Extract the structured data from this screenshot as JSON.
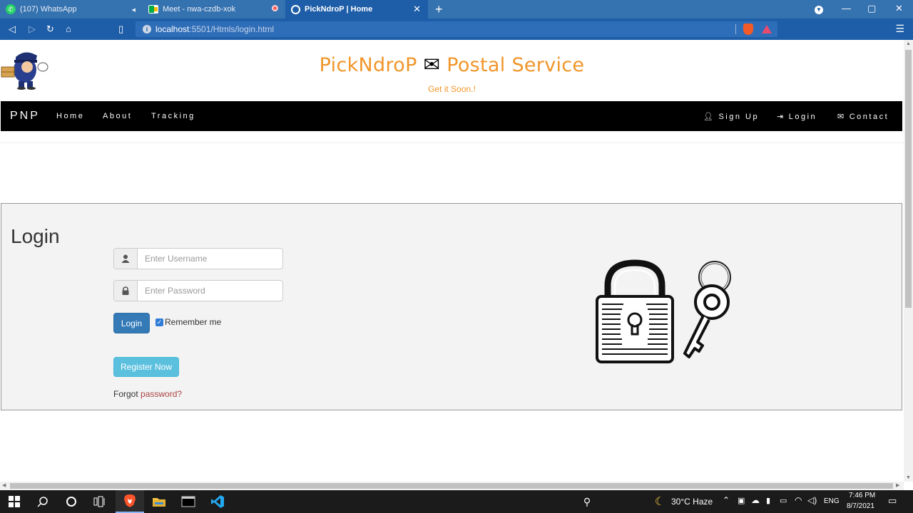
{
  "browser": {
    "tabs": [
      {
        "title": "(107) WhatsApp",
        "active": false
      },
      {
        "title": "Meet - nwa-czdb-xok",
        "active": false
      },
      {
        "title": "PickNdroP | Home",
        "active": true
      }
    ],
    "url_host": "localhost",
    "url_path": ":5501/Htmls/login.html"
  },
  "site": {
    "title_left": "PickNdroP",
    "title_icon": "✉",
    "title_right": "Postal Service",
    "tagline": "Get it Soon.!"
  },
  "nav": {
    "brand": "PNP",
    "left_links": [
      "Home",
      "About",
      "Tracking"
    ],
    "right_links": [
      {
        "label": "Sign Up",
        "icon": "user-icon"
      },
      {
        "label": "Login",
        "icon": "login-icon"
      },
      {
        "label": "Contact",
        "icon": "envelope-icon"
      }
    ]
  },
  "login": {
    "heading": "Login",
    "username_placeholder": "Enter Username",
    "password_placeholder": "Enter Password",
    "login_button": "Login",
    "remember_label": "Remember me",
    "remember_checked": true,
    "register_button": "Register Now",
    "forgot_prefix": "Forgot ",
    "forgot_link": "password?"
  },
  "taskbar": {
    "weather": "30°C  Haze",
    "language": "ENG",
    "time": "7:46 PM",
    "date": "8/7/2021"
  },
  "colors": {
    "accent_orange": "#f0962a",
    "browser_blue": "#1e5ea8",
    "btn_primary": "#337ab7",
    "btn_info": "#5bc0de",
    "link_red": "#a94442"
  }
}
